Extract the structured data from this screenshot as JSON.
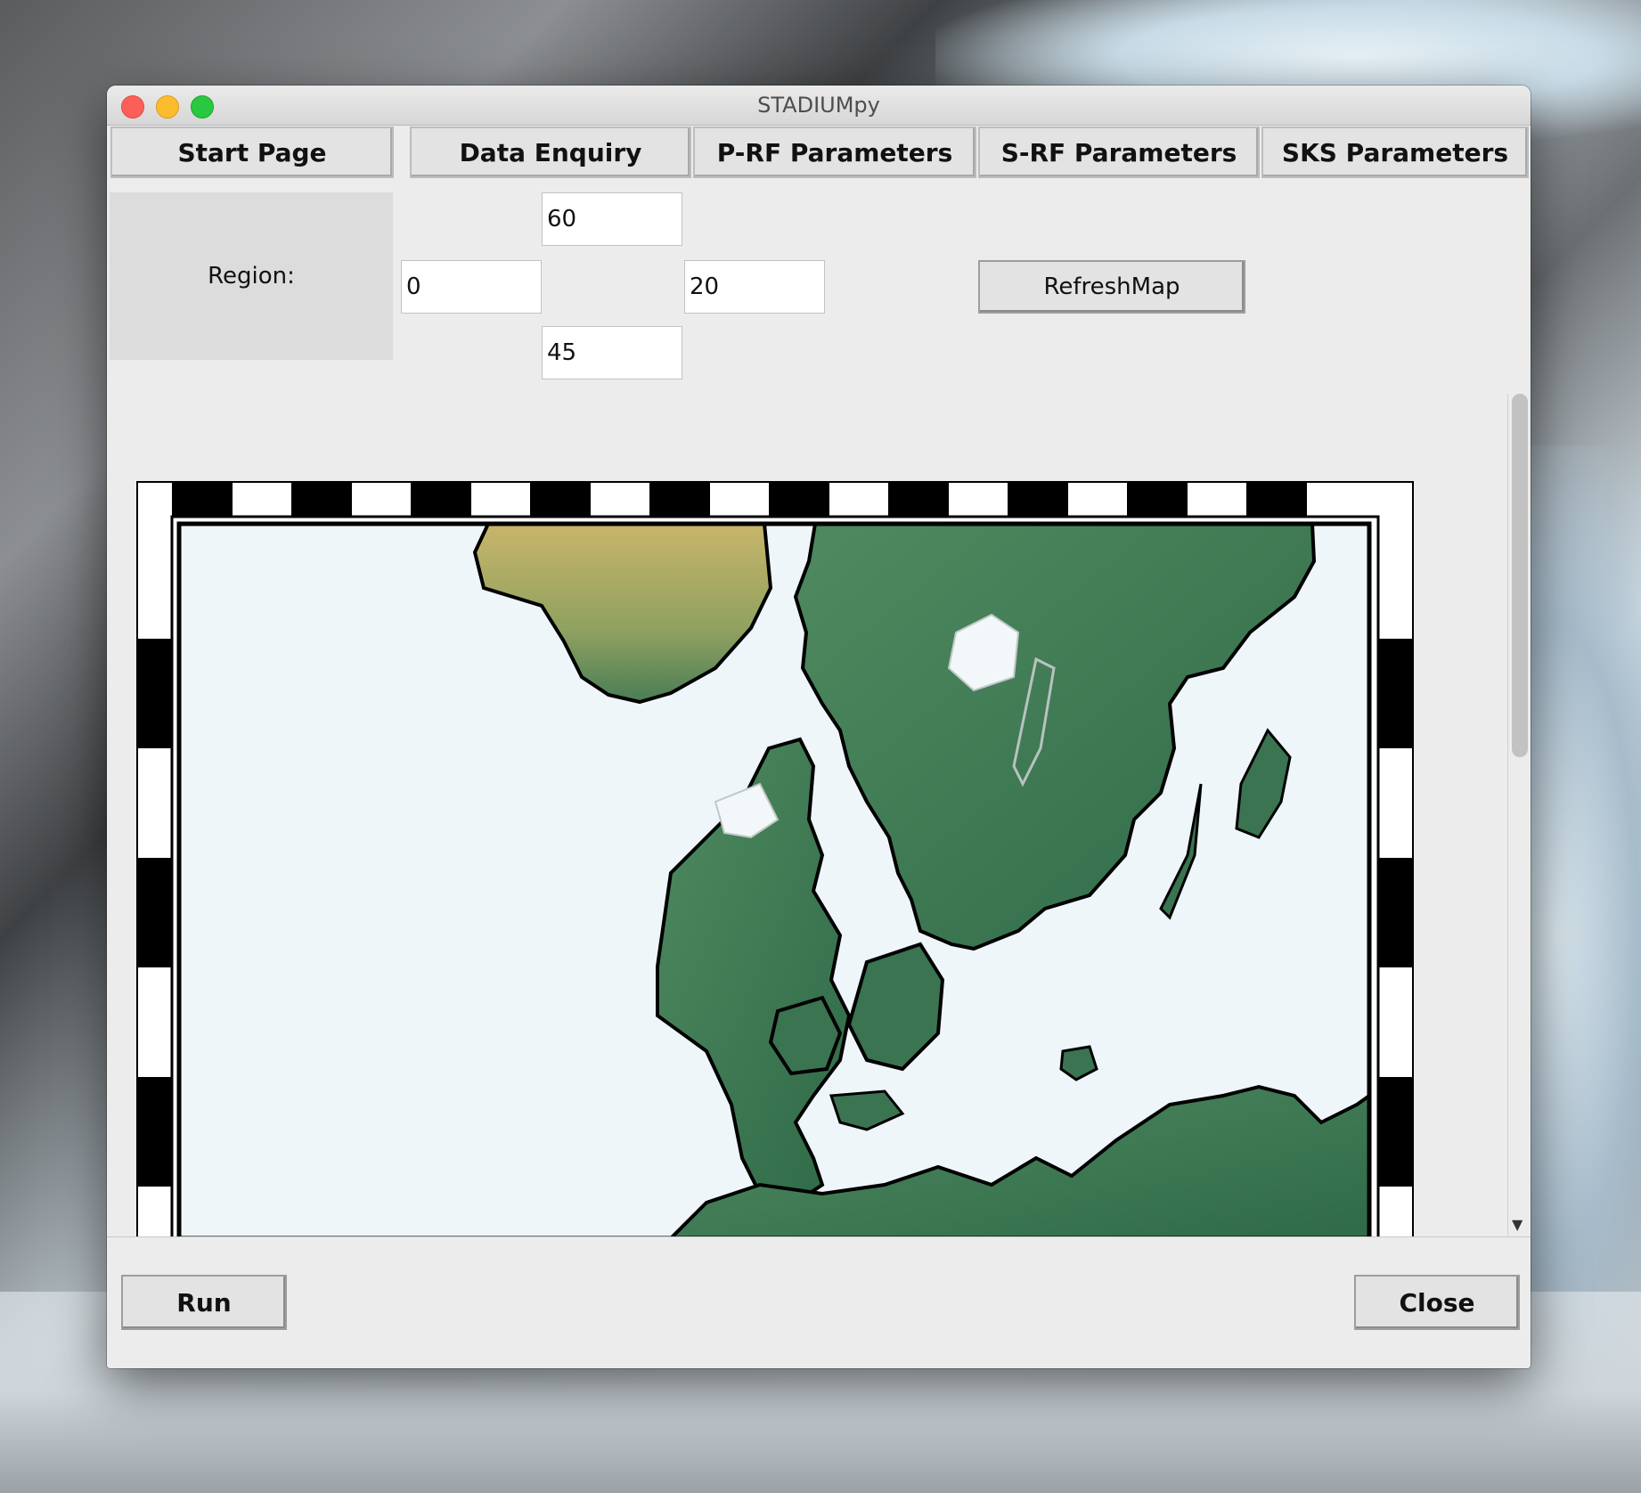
{
  "window": {
    "title": "STADIUMpy"
  },
  "tabs": [
    {
      "label": "Start Page"
    },
    {
      "label": "Data Enquiry"
    },
    {
      "label": "P-RF Parameters"
    },
    {
      "label": "S-RF Parameters"
    },
    {
      "label": "SKS Parameters"
    }
  ],
  "region": {
    "label": "Region:",
    "north": "60",
    "west": "0",
    "east": "20",
    "south": "45",
    "refresh_label": "RefreshMap"
  },
  "map": {
    "icon": "relief-map"
  },
  "footer": {
    "run_label": "Run",
    "close_label": "Close"
  },
  "colors": {
    "window_bg": "#ececec",
    "land": "#3f7a55",
    "water": "#eef6fa",
    "coast": "#000000"
  }
}
